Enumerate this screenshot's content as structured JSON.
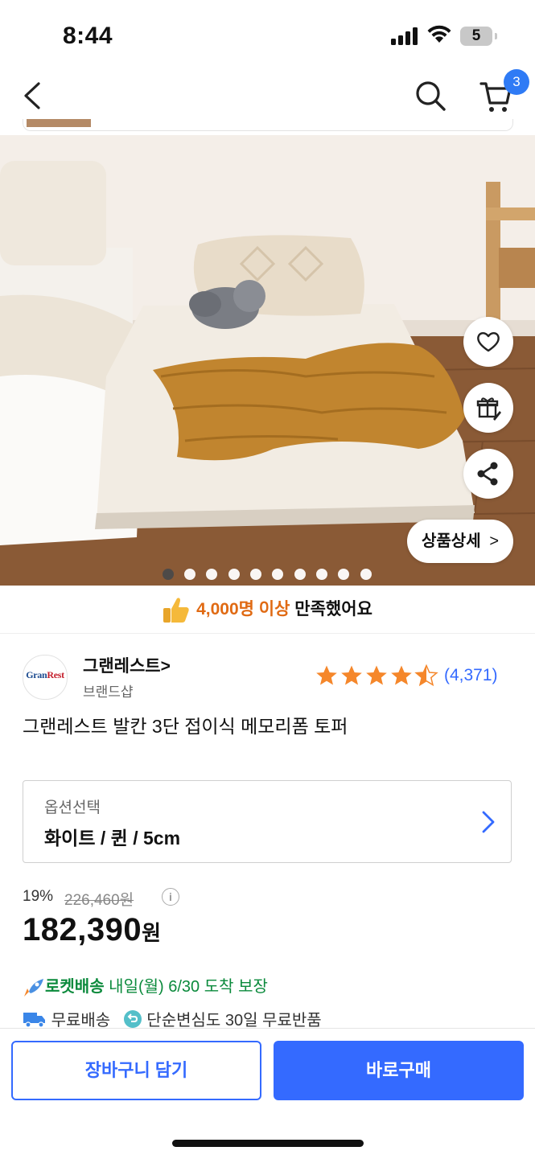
{
  "status_bar": {
    "time": "8:44",
    "battery": "5"
  },
  "nav": {
    "cart_count": "3"
  },
  "gallery": {
    "detail_button": "상품상세",
    "detail_chevron": ">",
    "total_images": 10,
    "active_index": 0
  },
  "satisfaction": {
    "highlight": "4,000명 이상",
    "text": " 만족했어요"
  },
  "brand": {
    "logo_text_1": "Gran",
    "logo_text_2": "Rest",
    "name": "그랜레스트>",
    "subtitle": "브랜드샵"
  },
  "rating": {
    "stars": 4.5,
    "review_count": "(4,371)"
  },
  "product": {
    "title": "그랜레스트 발칸 3단 접이식 메모리폼 토퍼"
  },
  "option": {
    "label": "옵션선택",
    "value": "화이트 / 퀸 / 5cm"
  },
  "pricing": {
    "discount": "19%",
    "original_price": "226,460원",
    "info_icon": "i",
    "price": "182,390",
    "currency": "원"
  },
  "delivery": {
    "rocket_label": "로켓배송",
    "rocket_text": " 내일(월) 6/30 도착 보장",
    "free_shipping": "무료배송",
    "return_text": "단순변심도 30일 무료반품"
  },
  "actions": {
    "add_to_cart": "장바구니 담기",
    "buy_now": "바로구매"
  },
  "colors": {
    "accent": "#346aff",
    "rocket_green": "#0b8a3c",
    "highlight_orange": "#e06a13",
    "star": "#f5872b"
  }
}
